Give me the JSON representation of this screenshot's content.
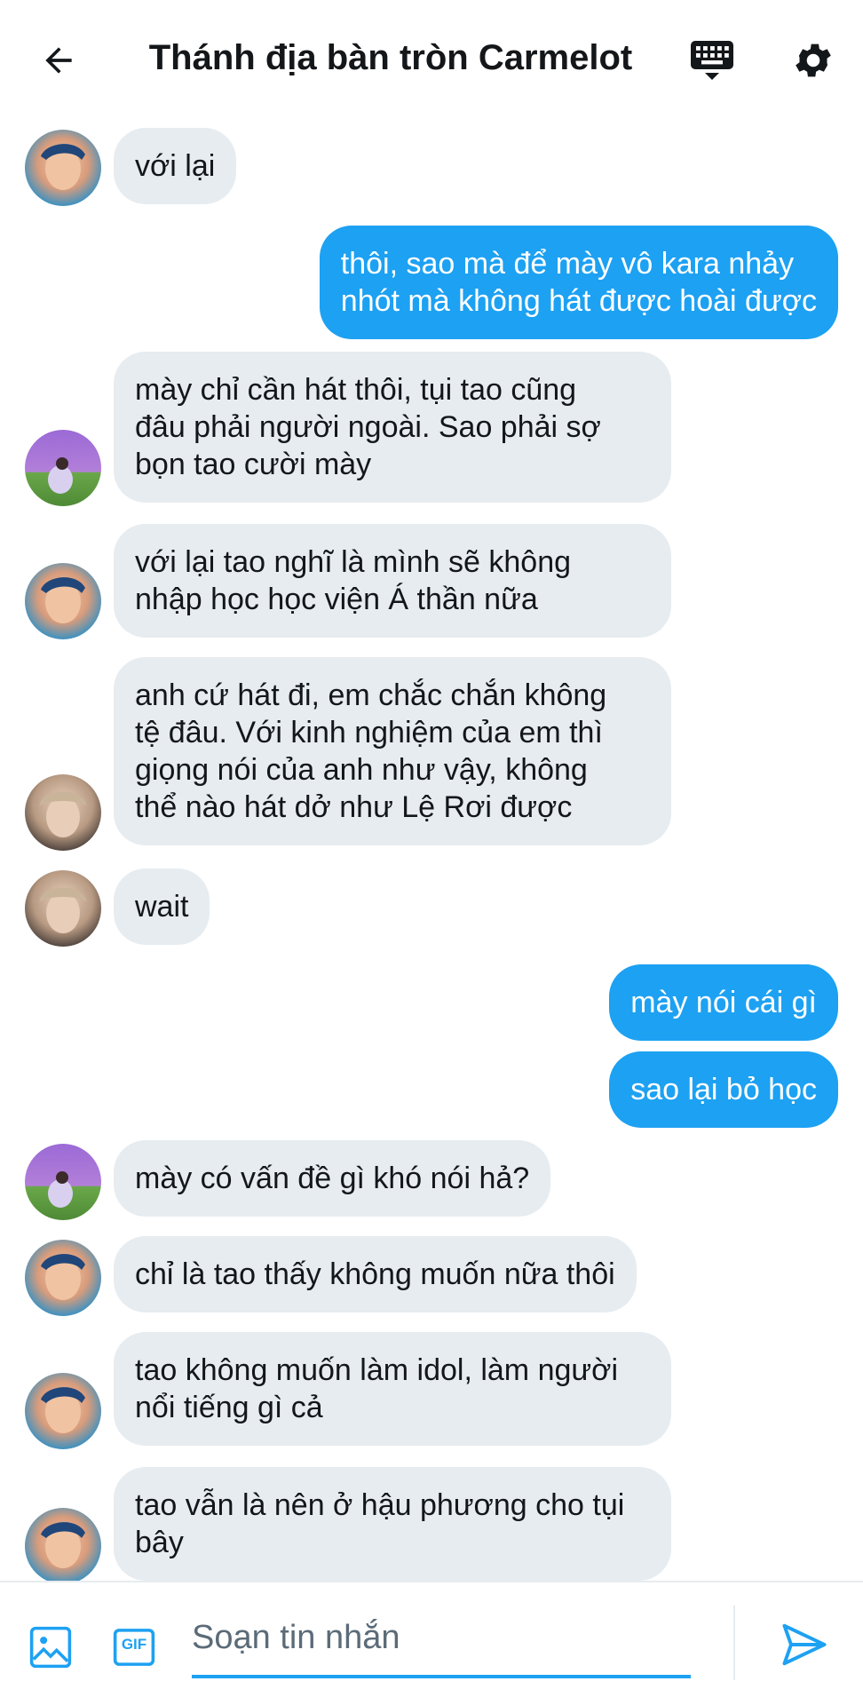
{
  "header": {
    "title": "Thánh địa bàn tròn Carmelot"
  },
  "messages": [
    {
      "dir": "in",
      "text": "với lại"
    },
    {
      "dir": "out",
      "text": "thôi, sao mà để mày vô kara nhảy\nnhót mà không hát được hoài được"
    },
    {
      "dir": "in",
      "text": "mày chỉ cần hát thôi, tụi tao cũng\nđâu phải người ngoài. Sao phải sợ\nbọn tao cười mày"
    },
    {
      "dir": "in",
      "text": "với lại tao nghĩ là mình sẽ không\nnhập học học viện Á thần nữa"
    },
    {
      "dir": "in",
      "text": "anh cứ hát đi, em chắc chắn không\ntệ đâu. Với kinh nghiệm của em thì\ngiọng nói của anh như vậy, không\nthể nào hát dở như Lệ Rơi được"
    },
    {
      "dir": "in",
      "text": "wait"
    },
    {
      "dir": "out",
      "text": "mày nói cái gì"
    },
    {
      "dir": "out",
      "text": "sao lại bỏ học"
    },
    {
      "dir": "in",
      "text": "mày có vấn đề gì khó nói hả?"
    },
    {
      "dir": "in",
      "text": "chỉ là tao thấy không muốn nữa thôi"
    },
    {
      "dir": "in",
      "text": "tao không muốn làm idol, làm người\nnổi tiếng gì cả"
    },
    {
      "dir": "in",
      "text": "tao vẫn là nên ở hậu phương cho tụi\nbây"
    }
  ],
  "composer": {
    "placeholder": "Soạn tin nhắn",
    "gif_label": "GIF"
  },
  "colors": {
    "accent": "#1da1f2",
    "bubble_in": "#e6ecf0",
    "text": "#14171a"
  },
  "icons": {
    "back": "arrow-left-icon",
    "keyboard": "keyboard-icon",
    "settings": "gear-icon",
    "image": "image-icon",
    "gif": "gif-icon",
    "send": "send-icon"
  }
}
